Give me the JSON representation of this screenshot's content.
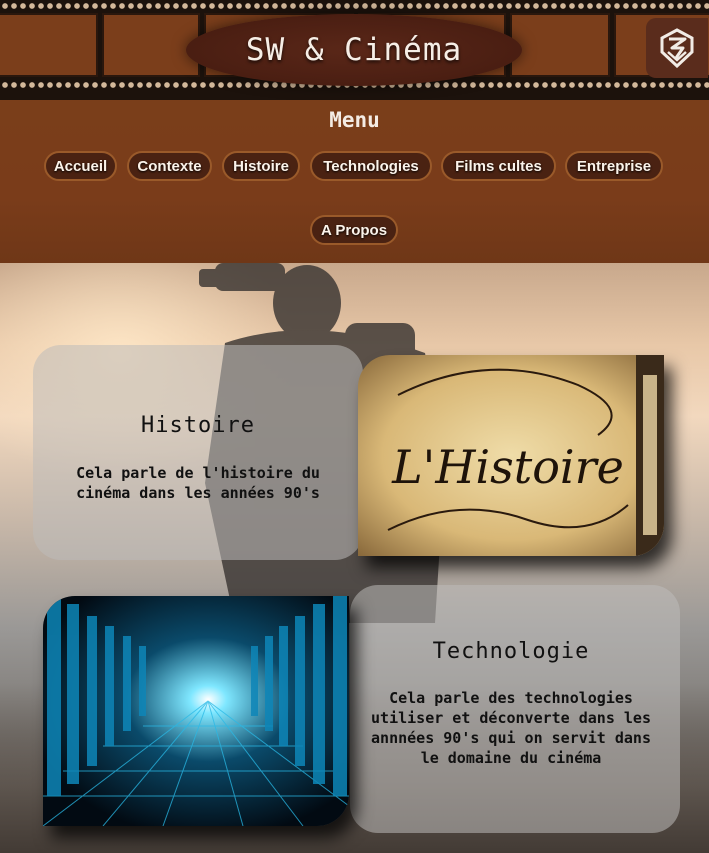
{
  "header": {
    "title": "SW & Cinéma",
    "logo_icon": "sw-monogram-icon",
    "film_frame_color": "#7b3e1b",
    "film_base_color": "#1c120c"
  },
  "menu": {
    "title": "Menu",
    "items": [
      {
        "label": "Accueil"
      },
      {
        "label": "Contexte"
      },
      {
        "label": "Histoire"
      },
      {
        "label": "Technologies"
      },
      {
        "label": "Films cultes"
      },
      {
        "label": "Entreprise"
      },
      {
        "label": "A Propos"
      }
    ]
  },
  "sections": {
    "histoire": {
      "heading": "Histoire",
      "description": "Cela parle de l'histoire du cinéma dans les années 90's",
      "image_text": "L'Histoire"
    },
    "technologie": {
      "heading": "Technologie",
      "description": "Cela parle des technologies utiliser et déconverte dans les annnées 90's qui on servit dans le domaine du cinéma"
    }
  },
  "colors": {
    "menu_bg": "#7a3e1a",
    "nav_button_bg": "#4a2212",
    "nav_button_border": "#9a5a2a",
    "title_oval": "#4a1e12"
  }
}
